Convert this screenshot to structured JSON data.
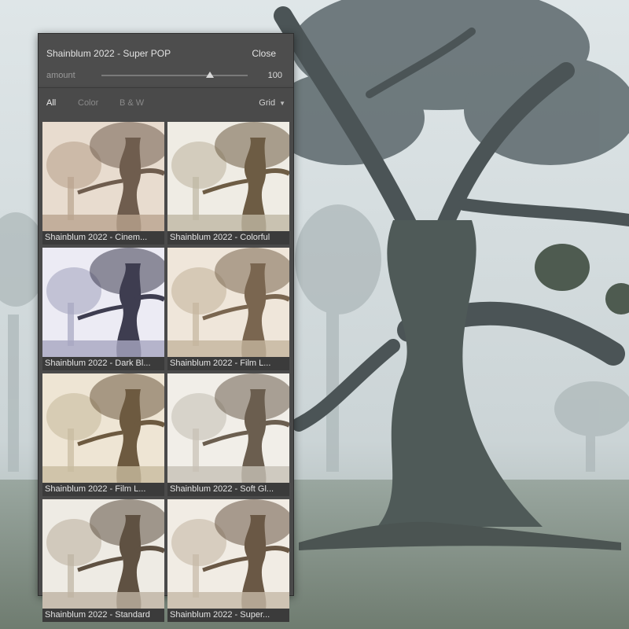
{
  "panel": {
    "preset_name": "Shainblum 2022 - Super POP",
    "close_label": "Close",
    "amount_label": "amount",
    "amount_value": "100",
    "amount_fraction": 1.0
  },
  "tabs": {
    "all": "All",
    "color": "Color",
    "bw": "B & W"
  },
  "view": {
    "selected": "Grid"
  },
  "presets": [
    {
      "label": "Shainblum 2022 - Cinem...",
      "tint": "#b9a48e",
      "shade": "#6f5d4e",
      "sky": "#e8dccf"
    },
    {
      "label": "Shainblum 2022 - Colorful",
      "tint": "#bfb8a4",
      "shade": "#6d5c44",
      "sky": "#efece4"
    },
    {
      "label": "Shainblum 2022 - Dark Bl...",
      "tint": "#a7a6c0",
      "shade": "#3e3d50",
      "sky": "#ecebf4"
    },
    {
      "label": "Shainblum 2022 - Film L...",
      "tint": "#c4b59e",
      "shade": "#7a6650",
      "sky": "#efe6da"
    },
    {
      "label": "Shainblum 2022 - Film L...",
      "tint": "#c8bb9f",
      "shade": "#6d5a40",
      "sky": "#eee5d4"
    },
    {
      "label": "Shainblum 2022 - Soft Gl...",
      "tint": "#c7c1b5",
      "shade": "#6b5e4f",
      "sky": "#f1eee8"
    },
    {
      "label": "Shainblum 2022 - Standard",
      "tint": "#beb3a2",
      "shade": "#5f5142",
      "sky": "#eeebe4"
    },
    {
      "label": "Shainblum 2022 - Super...",
      "tint": "#c6b9a6",
      "shade": "#6a5845",
      "sky": "#f1ece4"
    }
  ]
}
